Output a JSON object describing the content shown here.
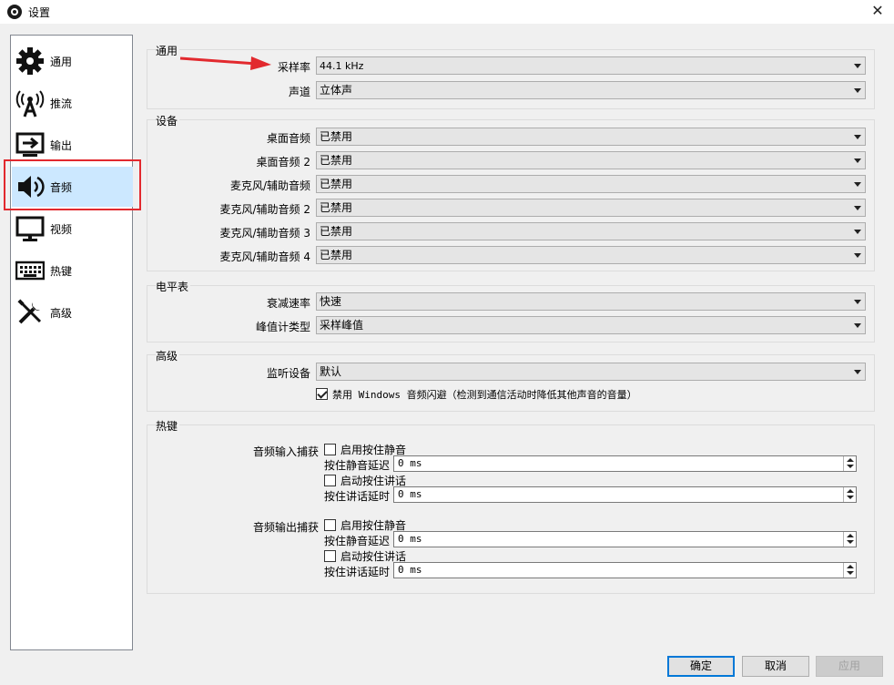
{
  "window": {
    "title": "设置",
    "close_glyph": "✕"
  },
  "sidebar": {
    "items": [
      {
        "label": "通用",
        "icon": "gear-icon"
      },
      {
        "label": "推流",
        "icon": "broadcast-icon"
      },
      {
        "label": "输出",
        "icon": "output-icon"
      },
      {
        "label": "音频",
        "icon": "speaker-icon",
        "selected": true
      },
      {
        "label": "视频",
        "icon": "monitor-icon"
      },
      {
        "label": "热键",
        "icon": "keyboard-icon"
      },
      {
        "label": "高级",
        "icon": "tools-icon"
      }
    ]
  },
  "groups": {
    "general": {
      "title": "通用",
      "sample_rate": {
        "label": "采样率",
        "value": "44.1 kHz"
      },
      "channels": {
        "label": "声道",
        "value": "立体声"
      }
    },
    "devices": {
      "title": "设备",
      "rows": [
        {
          "label": "桌面音频",
          "value": "已禁用"
        },
        {
          "label": "桌面音频 2",
          "value": "已禁用"
        },
        {
          "label": "麦克风/辅助音频",
          "value": "已禁用"
        },
        {
          "label": "麦克风/辅助音频 2",
          "value": "已禁用"
        },
        {
          "label": "麦克风/辅助音频 3",
          "value": "已禁用"
        },
        {
          "label": "麦克风/辅助音频 4",
          "value": "已禁用"
        }
      ]
    },
    "meters": {
      "title": "电平表",
      "decay": {
        "label": "衰减速率",
        "value": "快速"
      },
      "peak": {
        "label": "峰值计类型",
        "value": "采样峰值"
      }
    },
    "advanced": {
      "title": "高级",
      "monitor": {
        "label": "监听设备",
        "value": "默认"
      },
      "ducking": {
        "label": "禁用 Windows 音频闪避（检测到通信活动时降低其他声音的音量）",
        "checked": true
      }
    },
    "hotkeys": {
      "title": "热键",
      "blocks": [
        {
          "label": "音频输入捕获",
          "mute_check": "启用按住静音",
          "mute_delay_label": "按住静音延迟",
          "mute_delay_value": "0  ms",
          "ptt_check": "启动按住讲话",
          "ptt_delay_label": "按住讲话延时",
          "ptt_delay_value": "0  ms"
        },
        {
          "label": "音频输出捕获",
          "mute_check": "启用按住静音",
          "mute_delay_label": "按住静音延迟",
          "mute_delay_value": "0  ms",
          "ptt_check": "启动按住讲话",
          "ptt_delay_label": "按住讲话延时",
          "ptt_delay_value": "0  ms"
        }
      ]
    }
  },
  "buttons": {
    "ok": "确定",
    "cancel": "取消",
    "apply": "应用"
  },
  "colors": {
    "selection": "#cce8ff",
    "highlight": "#e2292e",
    "primary_border": "#0078d7"
  }
}
